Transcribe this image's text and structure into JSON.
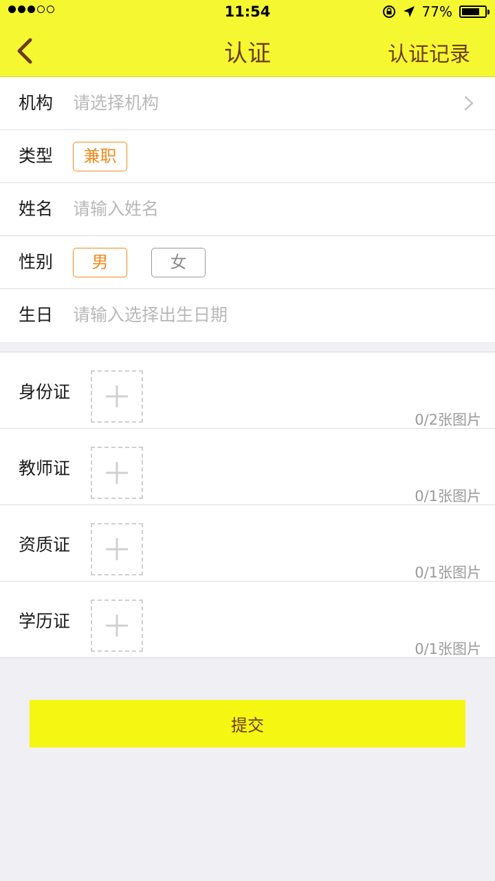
{
  "status_bar": {
    "time": "11:54",
    "battery_text": "77%",
    "battery_level": 0.77,
    "signal_filled": 3,
    "signal_total": 5,
    "icons": [
      "rotation-lock-icon",
      "location-arrow-icon",
      "battery-icon"
    ]
  },
  "nav": {
    "back_icon": "chevron-left-icon",
    "title": "认证",
    "right_action": "认证记录"
  },
  "form": {
    "institution": {
      "label": "机构",
      "placeholder": "请选择机构",
      "icon": "chevron-right-icon"
    },
    "type": {
      "label": "类型",
      "options": [
        "兼职"
      ],
      "selected": "兼职"
    },
    "name": {
      "label": "姓名",
      "placeholder": "请输入姓名"
    },
    "gender": {
      "label": "性别",
      "options": [
        "男",
        "女"
      ],
      "selected": "男"
    },
    "birthday": {
      "label": "生日",
      "placeholder": "请输入选择出生日期"
    }
  },
  "uploads": [
    {
      "label": "身份证",
      "count": "0/2张图片"
    },
    {
      "label": "教师证",
      "count": "0/1张图片"
    },
    {
      "label": "资质证",
      "count": "0/1张图片"
    },
    {
      "label": "学历证",
      "count": "0/1张图片"
    }
  ],
  "submit_label": "提交",
  "colors": {
    "header_bg": "#f5f731",
    "accent": "#f08a1c",
    "title_text": "#6b3d10",
    "page_bg": "#efeff4"
  }
}
